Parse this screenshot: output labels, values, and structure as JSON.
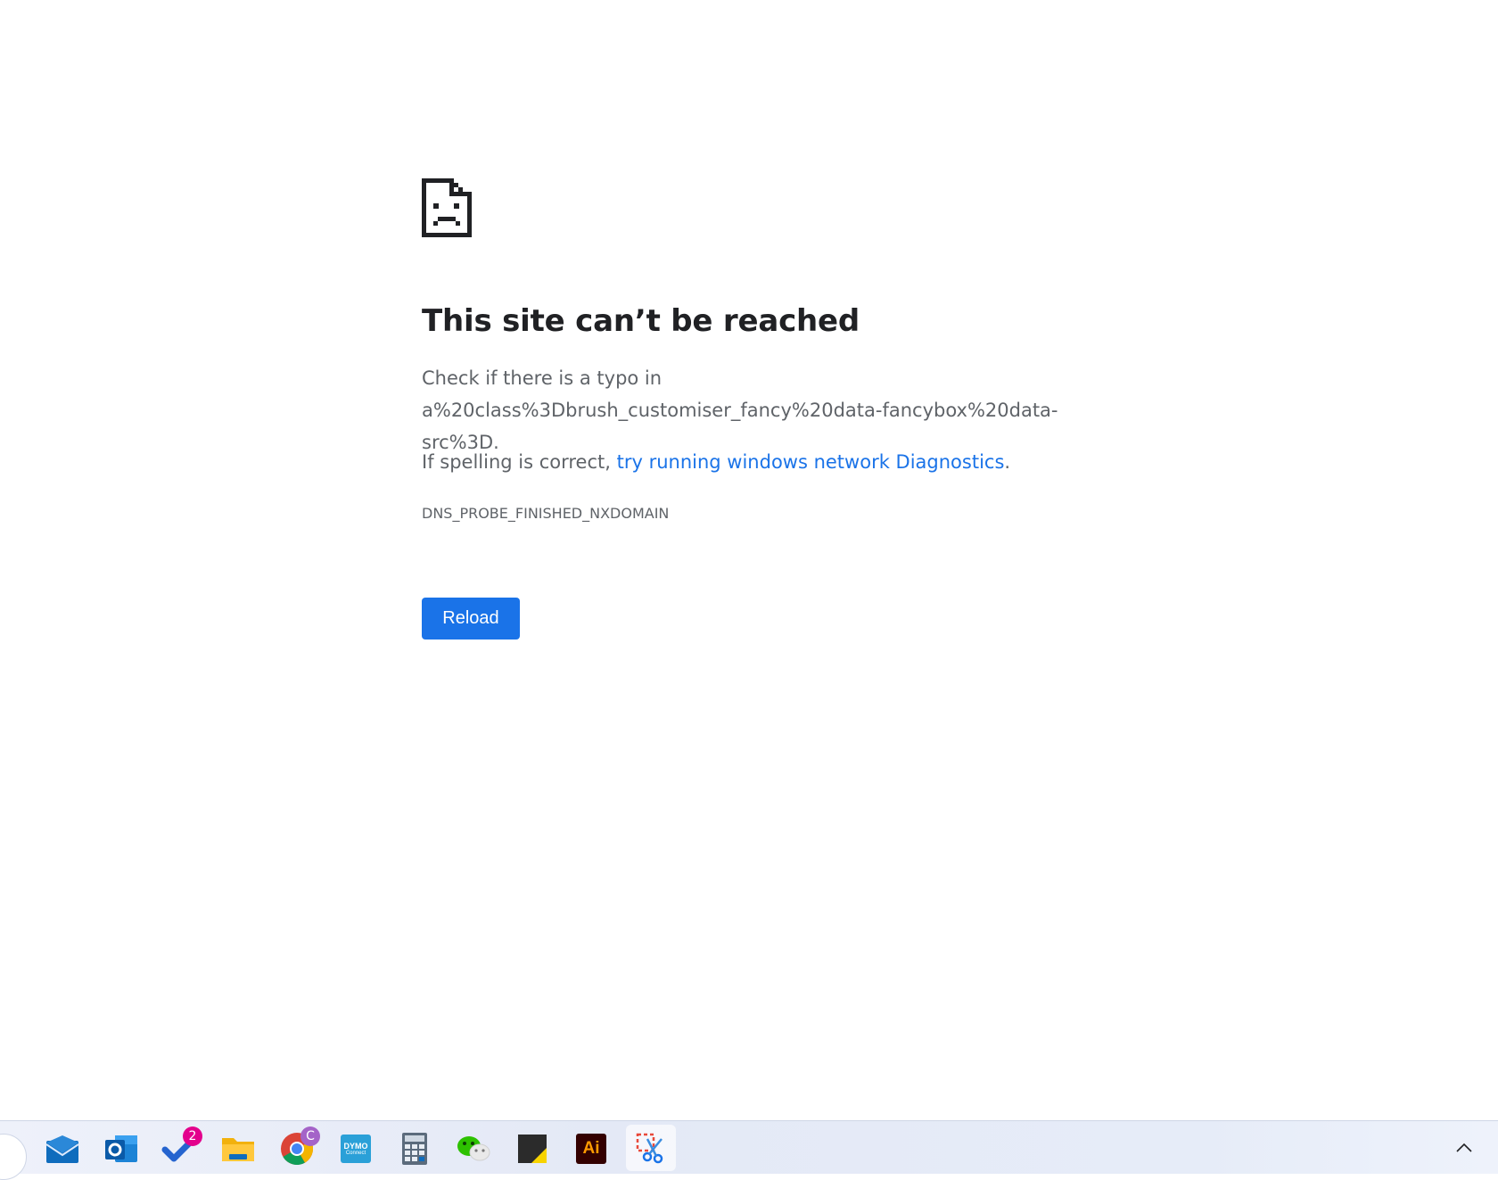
{
  "error_page": {
    "title": "This site can’t be reached",
    "typo_text": "Check if there is a typo in a%20class%3Dbrush_customiser_fancy%20data-fancybox%20data-src%3D.",
    "spelling_prefix": "If spelling is correct, ",
    "diagnostics_link": "try running windows network Diagnostics",
    "spelling_suffix": ".",
    "error_code": "DNS_PROBE_FINISHED_NXDOMAIN",
    "reload_label": "Reload",
    "icon": "sad-page-icon"
  },
  "taskbar": {
    "apps": [
      {
        "name": "mail",
        "icon": "mail-icon"
      },
      {
        "name": "outlook",
        "icon": "outlook-icon"
      },
      {
        "name": "todo",
        "icon": "todo-icon",
        "badge": "2"
      },
      {
        "name": "file-explorer",
        "icon": "folder-icon"
      },
      {
        "name": "chrome",
        "icon": "chrome-icon",
        "badge": "C"
      },
      {
        "name": "dymo-connect",
        "icon": "dymo-icon",
        "label_top": "DYMO",
        "label_bottom": "Connect"
      },
      {
        "name": "calculator",
        "icon": "calculator-icon"
      },
      {
        "name": "wechat",
        "icon": "wechat-icon"
      },
      {
        "name": "sticky-notes",
        "icon": "sticky-notes-icon"
      },
      {
        "name": "illustrator",
        "icon": "illustrator-icon",
        "label": "Ai"
      },
      {
        "name": "snipping-tool",
        "icon": "snipping-tool-icon"
      }
    ],
    "tray_icon": "chevron-up-icon"
  },
  "colors": {
    "accent": "#1a73e8",
    "text_dark": "#202124",
    "text_muted": "#5f6368"
  }
}
